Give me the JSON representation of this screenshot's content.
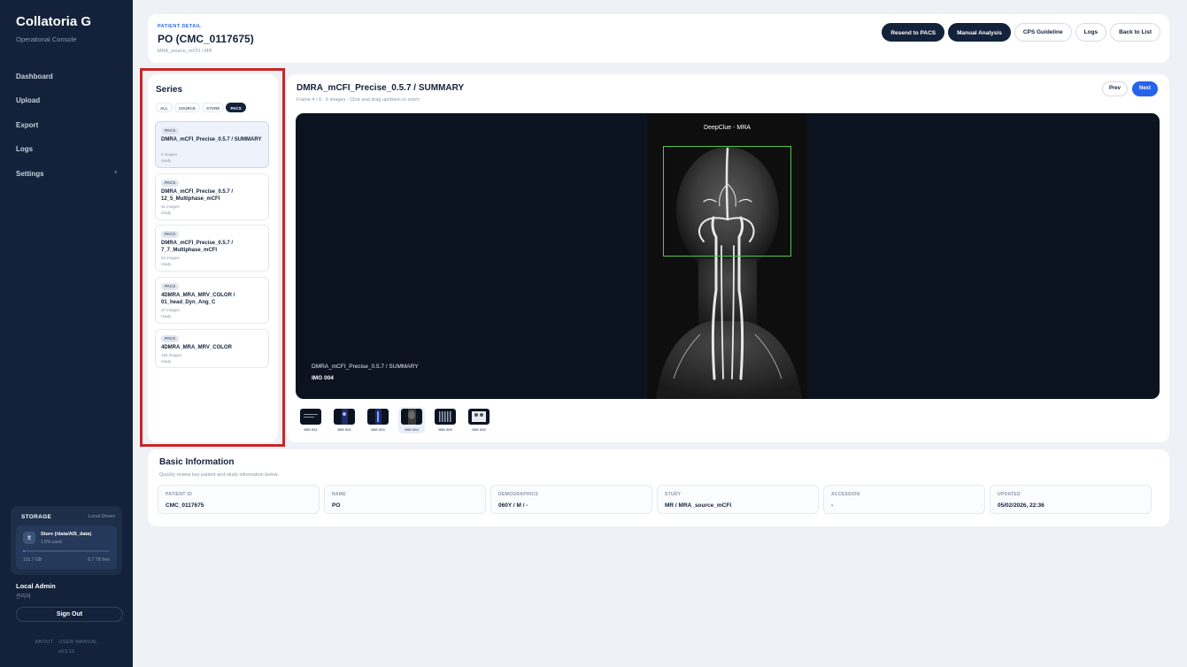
{
  "sidebar": {
    "brand": "Collatoria G",
    "brand_sub": "Operational Console",
    "nav": [
      {
        "label": "Dashboard"
      },
      {
        "label": "Upload"
      },
      {
        "label": "Export"
      },
      {
        "label": "Logs"
      },
      {
        "label": "Settings",
        "caret": "•"
      }
    ],
    "storage": {
      "title": "STORAGE",
      "type": "Local Drives",
      "store_icon": "drive-icon",
      "store_name": "Store (/data/AIS_data)",
      "used": "1.8% used",
      "used_fraction": 0.018,
      "size": "131.7 GB",
      "free": "6.7 TB free"
    },
    "user_name": "Local Admin",
    "user_role": "관리자",
    "signout": "Sign Out",
    "footer_links": "ABOUT · USER MANUAL",
    "version": "v0.5.12"
  },
  "header": {
    "kicker": "PATIENT DETAIL",
    "title": "PO (CMC_0117675)",
    "sub": "MRA_source_mCFI / MR",
    "buttons": [
      "Resend to PACS",
      "Manual Analysis",
      "CPS Guideline",
      "Logs",
      "Back to List"
    ]
  },
  "series": {
    "title": "Series",
    "filters": [
      "ALL",
      "SOURCE",
      "STORE",
      "PACS"
    ],
    "active_filter": "PACS",
    "items": [
      {
        "tag": "PACS",
        "name": "DMRA_mCFI_Precise_0.5.7 / SUMMARY",
        "count": "6 images",
        "status": "ready"
      },
      {
        "tag": "PACS",
        "name": "DMRA_mCFI_Precise_0.5.7 / 12_5_Multiphase_mCFI",
        "count": "31 images",
        "status": "ready"
      },
      {
        "tag": "PACS",
        "name": "DMRA_mCFI_Precise_0.5.7 / 7_7_Multiphase_mCFI",
        "count": "22 images",
        "status": "ready"
      },
      {
        "tag": "PACS",
        "name": "4DMRA_MRA_MRV_COLOR / 01_head_Dyn_Ang_C",
        "count": "27 images",
        "status": "ready"
      },
      {
        "tag": "PACS",
        "name": "4DMRA_MRA_MRV_COLOR",
        "count": "180 images",
        "status": "ready"
      }
    ]
  },
  "viewer": {
    "title": "DMRA_mCFI_Precise_0.5.7 / SUMMARY",
    "sub": "Frame 4 / 6 · 6 images · Click and drag up/down to zoom",
    "prev": "Prev",
    "next": "Next",
    "scan_label": "DeepClue - MRA",
    "overlay_series": "DMRA_mCFI_Precise_0.5.7 / SUMMARY",
    "overlay_img": "IMG 004",
    "thumbs": [
      "IMG 001",
      "IMG 002",
      "IMG 003",
      "IMG 004",
      "IMG 005",
      "IMG 006"
    ],
    "active_thumb": "IMG 004"
  },
  "info": {
    "title": "Basic Information",
    "sub": "Quickly review key patient and study information below.",
    "fields": [
      {
        "label": "PATIENT ID",
        "value": "CMC_0117675"
      },
      {
        "label": "NAME",
        "value": "PO"
      },
      {
        "label": "DEMOGRAPHICS",
        "value": "060Y / M / -"
      },
      {
        "label": "STUDY",
        "value": "MR / MRA_source_mCFI"
      },
      {
        "label": "ACCESSION",
        "value": "-"
      },
      {
        "label": "UPDATED",
        "value": "05/02/2026, 22:36"
      }
    ]
  },
  "colors": {
    "sidebar_bg": "#13223a",
    "accent": "#2563eb",
    "highlight_border": "#c62828",
    "roi_box": "#52c452"
  }
}
